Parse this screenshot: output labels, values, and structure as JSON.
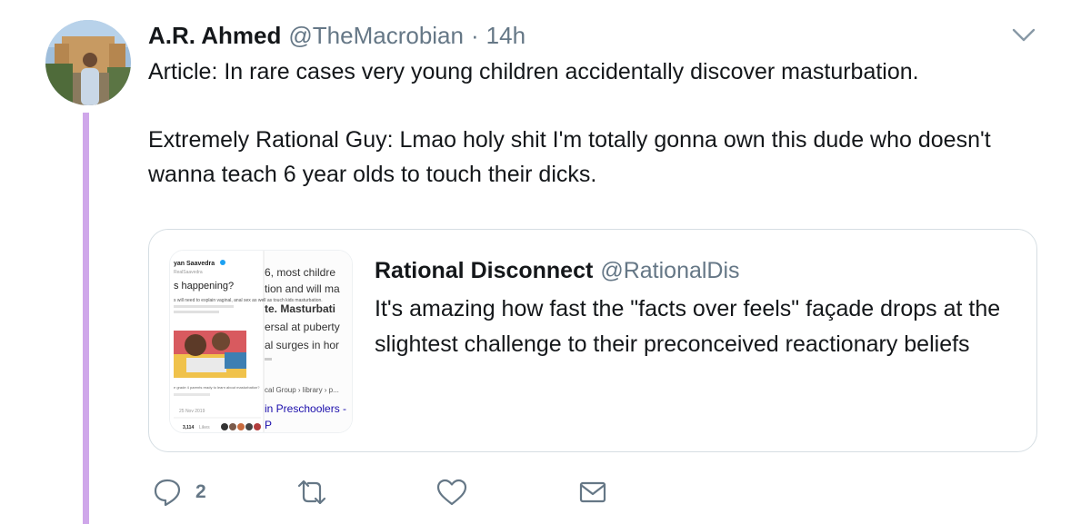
{
  "tweet": {
    "author_name": "A.R. Ahmed",
    "author_handle": "@TheMacrobian",
    "separator": "·",
    "time": "14h",
    "text_line1": "Article: In rare cases very young children accidentally discover masturbation.",
    "text_line2": "Extremely Rational Guy: Lmao holy shit I'm totally gonna own this dude who doesn't wanna teach 6 year olds to touch their dicks."
  },
  "quoted": {
    "author_name": "Rational Disconnect",
    "author_handle": "@RationalDis",
    "text": "It's amazing how fast the \"facts over feels\" façade drops at the slightest challenge to their preconceived reactionary beliefs",
    "thumbnail": {
      "left_name": "yan Saavedra",
      "left_handle": "RealSaavedra",
      "left_question": "s happening?",
      "left_body": "s will need to explain vaginal, anal sex as well as touch kids masturbation.",
      "left_caption": "e grade 4 parents ready to learn about masturbation?",
      "left_date": "25 Nov 2019",
      "left_likes": "3,114",
      "left_likes_label": "Likes",
      "right_line1": "6, most childre",
      "right_line2": "tion and will ma",
      "right_line3": "te. Masturbati",
      "right_line4": "ersal at puberty",
      "right_line5": "al surges in hor",
      "right_line6": "cal Group › library › p...",
      "right_line7": "in Preschoolers -",
      "right_line8": "P"
    }
  },
  "actions": {
    "reply_count": "2"
  },
  "colors": {
    "thread_line": "#cfa7ea",
    "secondary_text": "#657786",
    "primary_text": "#14171a",
    "border": "#d6dee3",
    "link": "#1b95e0"
  },
  "icons": [
    "chevron-down-icon",
    "reply-icon",
    "retweet-icon",
    "like-icon",
    "message-icon"
  ]
}
